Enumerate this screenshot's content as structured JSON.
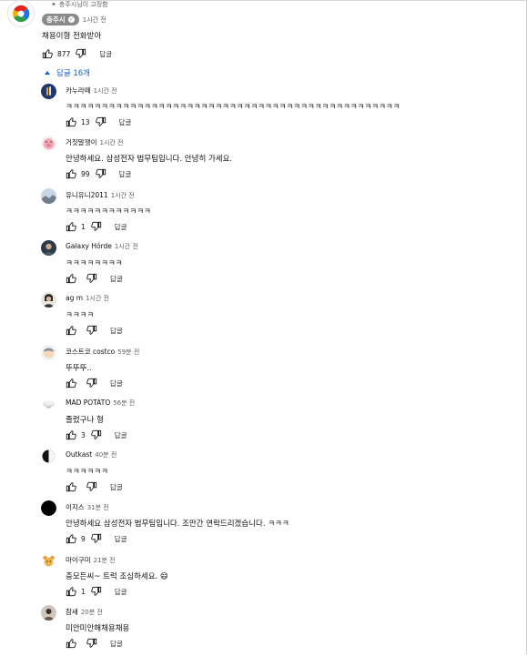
{
  "pinned_label": "충주시님이 고정함",
  "comment": {
    "author": "충주시",
    "time": "1시간 전",
    "text": "채용이형 전화받아",
    "likes": "877",
    "reply_label": "답글"
  },
  "replies_toggle": "답글 16개",
  "replies": [
    {
      "author": "카누라떼",
      "time": "1시간 전",
      "text": "ㅋㅋㅋㅋㅋㅋㅋㅋㅋㅋㅋㅋㅋㅋㅋㅋㅋㅋㅋㅋㅋㅋㅋㅋㅋㅋㅋㅋㅋㅋㅋㅋㅋㅋㅋㅋㅋㅋㅋㅋㅋㅋㅋㅋㅋㅋㅋ",
      "likes": "13",
      "reply_label": "답글"
    },
    {
      "author": "거짓말쟁이",
      "time": "1시간 전",
      "text": "안녕하세요. 삼성전자 법무팀입니다. 안녕히 가세요.",
      "likes": "99",
      "reply_label": "답글"
    },
    {
      "author": "유니유니2011",
      "time": "1시간 전",
      "text": "ㅋㅋㅋㅋㅋㅋㅋㅋㅋㅋㅋㅋ",
      "likes": "1",
      "reply_label": "답글"
    },
    {
      "author": "Galaxy Hórde",
      "time": "1시간 전",
      "text": "ㅋㅋㅋㅋㅋㅋㅋㅋ",
      "likes": "",
      "reply_label": "답글"
    },
    {
      "author": "ag m",
      "time": "1시간 전",
      "text": "ㅋㅋㅋㅋ",
      "likes": "",
      "reply_label": "답글"
    },
    {
      "author": "코스트코 costco",
      "time": "59분 전",
      "text": "뚜뚜뚜..",
      "likes": "",
      "reply_label": "답글"
    },
    {
      "author": "MAD POTATO",
      "time": "56분 전",
      "text": "졸렸구나 형",
      "likes": "3",
      "reply_label": "답글"
    },
    {
      "author": "Outkast",
      "time": "40분 전",
      "text": "ㅋㅋㅋㅋㅋㅋ",
      "likes": "",
      "reply_label": "답글"
    },
    {
      "author": "이지스",
      "time": "31분 전",
      "text": "안녕하세요 삼성전자 법무팀입니다. 조만간 연락드리겠습니다. ㅋㅋㅋ",
      "likes": "9",
      "reply_label": "답글"
    },
    {
      "author": "마이구미",
      "time": "21분 전",
      "text": "충모든씨~ 트럭 조심하세요. 😄",
      "likes": "1",
      "reply_label": "답글"
    },
    {
      "author": "참새",
      "time": "20분 전",
      "text": "미안미안해채용채용",
      "likes": "",
      "reply_label": "답글"
    }
  ],
  "icons": {
    "like": "thumbs-up-icon",
    "dislike": "thumbs-down-icon",
    "pin": "pin-icon",
    "verified": "check-icon",
    "caret": "caret-up-icon"
  },
  "colors": {
    "link_blue": "#065fd4",
    "owner_chip": "#8a8a8a",
    "secondary_text": "#606060"
  }
}
